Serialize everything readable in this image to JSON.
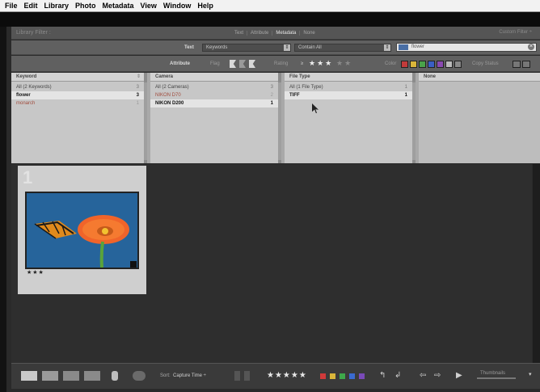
{
  "menu": [
    "File",
    "Edit",
    "Library",
    "Photo",
    "Metadata",
    "View",
    "Window",
    "Help"
  ],
  "filter_bar": {
    "title": "Library Filter :",
    "tabs": [
      "Text",
      "Attribute",
      "Metadata",
      "None"
    ],
    "active_tab": "Metadata",
    "preset": "Custom Filter ÷"
  },
  "text_row": {
    "label": "Text",
    "field": "Keywords",
    "rule": "Contain All",
    "search_value": "flower"
  },
  "attribute_row": {
    "label": "Attribute",
    "flag_label": "Flag",
    "rating_label": "Rating",
    "rating_op": "≥",
    "color_label": "Color",
    "copy_status_label": "Copy Status",
    "colors": [
      "#c23b3b",
      "#d9b53a",
      "#4aa34a",
      "#3a5fc4",
      "#8a4ab0",
      "#bbbbbb",
      "#888888"
    ]
  },
  "columns": [
    {
      "header": "Keyword",
      "rows": [
        {
          "label": "All (2 Keywords)",
          "count": "3"
        },
        {
          "label": "flower",
          "count": "3",
          "selected": true
        },
        {
          "label": "monarch",
          "count": "1",
          "accent": true
        }
      ]
    },
    {
      "header": "Camera",
      "rows": [
        {
          "label": "All (2 Cameras)",
          "count": "3"
        },
        {
          "label": "NIKON D70",
          "count": "2",
          "accent": true
        },
        {
          "label": "NIKON D200",
          "count": "1",
          "selected": true
        }
      ]
    },
    {
      "header": "File Type",
      "rows": [
        {
          "label": "All (1 File Type)",
          "count": "1"
        },
        {
          "label": "TIFF",
          "count": "1",
          "selected": true
        }
      ]
    },
    {
      "header": "None",
      "rows": []
    }
  ],
  "grid": {
    "cell_index": "1",
    "rating": "★★★"
  },
  "toolbar": {
    "sort_label": "Sort:",
    "sort_value": "Capture Time ÷",
    "stars": "★★★★★",
    "swatches": [
      "#d03a3a",
      "#d9b53a",
      "#3ea84a",
      "#3a6ad0",
      "#7a4ab8"
    ],
    "thumbnails_label": "Thumbnails"
  }
}
